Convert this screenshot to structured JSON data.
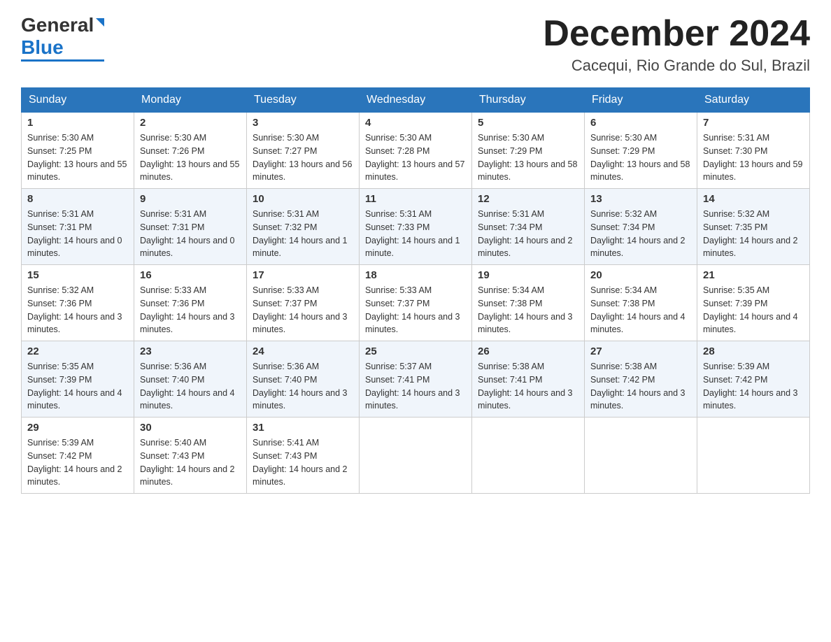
{
  "header": {
    "month_title": "December 2024",
    "location": "Cacequi, Rio Grande do Sul, Brazil",
    "logo_general": "General",
    "logo_blue": "Blue"
  },
  "weekdays": [
    "Sunday",
    "Monday",
    "Tuesday",
    "Wednesday",
    "Thursday",
    "Friday",
    "Saturday"
  ],
  "weeks": [
    [
      {
        "day": "1",
        "sunrise": "5:30 AM",
        "sunset": "7:25 PM",
        "daylight": "13 hours and 55 minutes."
      },
      {
        "day": "2",
        "sunrise": "5:30 AM",
        "sunset": "7:26 PM",
        "daylight": "13 hours and 55 minutes."
      },
      {
        "day": "3",
        "sunrise": "5:30 AM",
        "sunset": "7:27 PM",
        "daylight": "13 hours and 56 minutes."
      },
      {
        "day": "4",
        "sunrise": "5:30 AM",
        "sunset": "7:28 PM",
        "daylight": "13 hours and 57 minutes."
      },
      {
        "day": "5",
        "sunrise": "5:30 AM",
        "sunset": "7:29 PM",
        "daylight": "13 hours and 58 minutes."
      },
      {
        "day": "6",
        "sunrise": "5:30 AM",
        "sunset": "7:29 PM",
        "daylight": "13 hours and 58 minutes."
      },
      {
        "day": "7",
        "sunrise": "5:31 AM",
        "sunset": "7:30 PM",
        "daylight": "13 hours and 59 minutes."
      }
    ],
    [
      {
        "day": "8",
        "sunrise": "5:31 AM",
        "sunset": "7:31 PM",
        "daylight": "14 hours and 0 minutes."
      },
      {
        "day": "9",
        "sunrise": "5:31 AM",
        "sunset": "7:31 PM",
        "daylight": "14 hours and 0 minutes."
      },
      {
        "day": "10",
        "sunrise": "5:31 AM",
        "sunset": "7:32 PM",
        "daylight": "14 hours and 1 minute."
      },
      {
        "day": "11",
        "sunrise": "5:31 AM",
        "sunset": "7:33 PM",
        "daylight": "14 hours and 1 minute."
      },
      {
        "day": "12",
        "sunrise": "5:31 AM",
        "sunset": "7:34 PM",
        "daylight": "14 hours and 2 minutes."
      },
      {
        "day": "13",
        "sunrise": "5:32 AM",
        "sunset": "7:34 PM",
        "daylight": "14 hours and 2 minutes."
      },
      {
        "day": "14",
        "sunrise": "5:32 AM",
        "sunset": "7:35 PM",
        "daylight": "14 hours and 2 minutes."
      }
    ],
    [
      {
        "day": "15",
        "sunrise": "5:32 AM",
        "sunset": "7:36 PM",
        "daylight": "14 hours and 3 minutes."
      },
      {
        "day": "16",
        "sunrise": "5:33 AM",
        "sunset": "7:36 PM",
        "daylight": "14 hours and 3 minutes."
      },
      {
        "day": "17",
        "sunrise": "5:33 AM",
        "sunset": "7:37 PM",
        "daylight": "14 hours and 3 minutes."
      },
      {
        "day": "18",
        "sunrise": "5:33 AM",
        "sunset": "7:37 PM",
        "daylight": "14 hours and 3 minutes."
      },
      {
        "day": "19",
        "sunrise": "5:34 AM",
        "sunset": "7:38 PM",
        "daylight": "14 hours and 3 minutes."
      },
      {
        "day": "20",
        "sunrise": "5:34 AM",
        "sunset": "7:38 PM",
        "daylight": "14 hours and 4 minutes."
      },
      {
        "day": "21",
        "sunrise": "5:35 AM",
        "sunset": "7:39 PM",
        "daylight": "14 hours and 4 minutes."
      }
    ],
    [
      {
        "day": "22",
        "sunrise": "5:35 AM",
        "sunset": "7:39 PM",
        "daylight": "14 hours and 4 minutes."
      },
      {
        "day": "23",
        "sunrise": "5:36 AM",
        "sunset": "7:40 PM",
        "daylight": "14 hours and 4 minutes."
      },
      {
        "day": "24",
        "sunrise": "5:36 AM",
        "sunset": "7:40 PM",
        "daylight": "14 hours and 3 minutes."
      },
      {
        "day": "25",
        "sunrise": "5:37 AM",
        "sunset": "7:41 PM",
        "daylight": "14 hours and 3 minutes."
      },
      {
        "day": "26",
        "sunrise": "5:38 AM",
        "sunset": "7:41 PM",
        "daylight": "14 hours and 3 minutes."
      },
      {
        "day": "27",
        "sunrise": "5:38 AM",
        "sunset": "7:42 PM",
        "daylight": "14 hours and 3 minutes."
      },
      {
        "day": "28",
        "sunrise": "5:39 AM",
        "sunset": "7:42 PM",
        "daylight": "14 hours and 3 minutes."
      }
    ],
    [
      {
        "day": "29",
        "sunrise": "5:39 AM",
        "sunset": "7:42 PM",
        "daylight": "14 hours and 2 minutes."
      },
      {
        "day": "30",
        "sunrise": "5:40 AM",
        "sunset": "7:43 PM",
        "daylight": "14 hours and 2 minutes."
      },
      {
        "day": "31",
        "sunrise": "5:41 AM",
        "sunset": "7:43 PM",
        "daylight": "14 hours and 2 minutes."
      },
      null,
      null,
      null,
      null
    ]
  ],
  "labels": {
    "sunrise": "Sunrise:",
    "sunset": "Sunset:",
    "daylight": "Daylight:"
  }
}
